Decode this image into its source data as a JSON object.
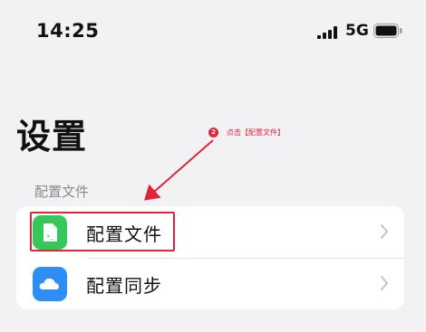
{
  "status_bar": {
    "time": "14:25",
    "network": "5G",
    "icons": [
      "cellular-signal-icon",
      "battery-icon"
    ]
  },
  "page": {
    "title": "设置"
  },
  "annotation": {
    "step_number": "2",
    "text": "点击【配置文件】",
    "color": "#e0243a"
  },
  "section": {
    "header": "配置文件",
    "items": [
      {
        "label": "配置文件",
        "icon": "profile-document-icon",
        "icon_color": "#34c759"
      },
      {
        "label": "配置同步",
        "icon": "cloud-icon",
        "icon_color": "#2f8ef4"
      }
    ]
  }
}
